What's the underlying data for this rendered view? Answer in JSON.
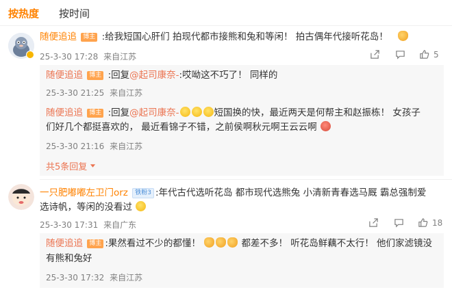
{
  "tabs": [
    {
      "label": "按热度"
    },
    {
      "label": "按时间"
    }
  ],
  "colors": {
    "accent": "#ff8200",
    "link": "#eb7350",
    "meta": "#808080"
  },
  "comments": [
    {
      "author": "随便追追",
      "badge": "博主",
      "text": ":给我短国心肝们 拍现代都市接熊和兔和等闲！ 拍古偶年代接听花岛！",
      "time": "25-3-30 17:28",
      "location": "来自江苏",
      "likes": "5",
      "replies": [
        {
          "author": "随便追追",
          "badge": "博主",
          "prefix": ":回复",
          "mention": "@起司康奈-",
          "text": ":哎呦这不巧了！ 同样的",
          "time": "25-3-30 21:25",
          "location": "来自江苏"
        },
        {
          "author": "随便追追",
          "badge": "博主",
          "prefix": ":回复",
          "mention": "@起司康奈-",
          "text_line1": "短国换的快，最近两天是何帮主和赵振栋！ 女孩子",
          "text_line2": "们好几个都挺喜欢的， 最近看锦子不错，之前侯啊秋元啊王云云啊",
          "time": "25-3-30 21:16",
          "location": "来自江苏"
        }
      ],
      "more_replies": "共5条回复"
    },
    {
      "author": "一只肥嘟嘟左卫门orz",
      "badge": "铁粉3",
      "text_line1": ":年代古代选听花岛 都市现代选熊兔 小清新青春选马厩 霸总强制爱",
      "text_line2": "选诗帆，等闲的没看过",
      "time": "25-3-30 17:31",
      "location": "来自广东",
      "likes": "18",
      "replies": [
        {
          "author": "随便追追",
          "badge": "博主",
          "text_a": ":果然看过不少的都懂！",
          "text_b": "都差不多！ 听花岛鲜藕不太行！ 他们家滤镜没",
          "text_line2": "有熊和兔好",
          "time": "25-3-30 17:32",
          "location": "来自江苏"
        }
      ]
    }
  ]
}
